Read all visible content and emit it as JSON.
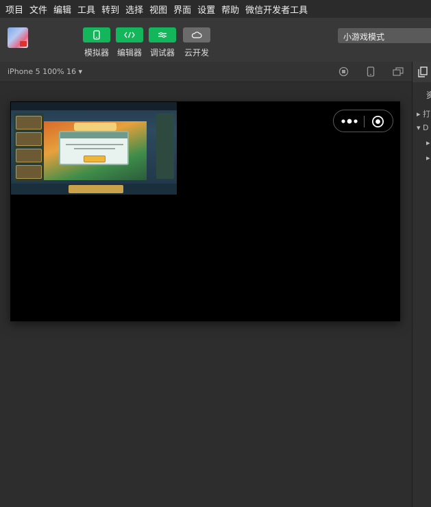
{
  "menu": [
    "项目",
    "文件",
    "编辑",
    "工具",
    "转到",
    "选择",
    "视图",
    "界面",
    "设置",
    "帮助",
    "微信开发者工具"
  ],
  "toolbar": {
    "simulator_label": "模拟器",
    "editor_label": "编辑器",
    "debugger_label": "调试器",
    "cloud_label": "云开发",
    "mode_select_value": "小游戏模式"
  },
  "simulator_bar": {
    "device_info": "iPhone 5 100% 16 ▾"
  },
  "right_panel": {
    "tab_label": "资",
    "row_1": "▸ 打",
    "row_2": "▾ D",
    "row_3": "▸",
    "row_4": "▸"
  },
  "colors": {
    "accent_green": "#13b65b",
    "stage_background": "#000000",
    "workspace_background": "#2d2d2d"
  }
}
